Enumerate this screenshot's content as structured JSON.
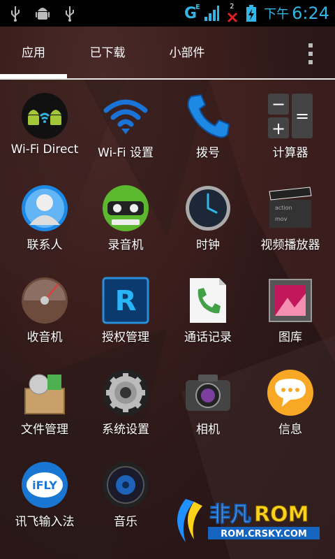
{
  "status_bar": {
    "network": "G",
    "network_sup": "E",
    "sim_slot": "2",
    "time_prefix": "下午",
    "time": "6:24",
    "accent_color": "#33b5e5"
  },
  "tabs": [
    {
      "label": "应用",
      "active": true
    },
    {
      "label": "已下载",
      "active": false
    },
    {
      "label": "小部件",
      "active": false
    }
  ],
  "apps": [
    {
      "label": "Wi-Fi Direct",
      "icon": "wifi-direct-icon"
    },
    {
      "label": "Wi-Fi 设置",
      "icon": "wifi-icon"
    },
    {
      "label": "拨号",
      "icon": "phone-icon"
    },
    {
      "label": "计算器",
      "icon": "calculator-icon"
    },
    {
      "label": "联系人",
      "icon": "contacts-icon"
    },
    {
      "label": "录音机",
      "icon": "recorder-icon"
    },
    {
      "label": "时钟",
      "icon": "clock-icon"
    },
    {
      "label": "视频播放器",
      "icon": "video-player-icon"
    },
    {
      "label": "收音机",
      "icon": "radio-icon"
    },
    {
      "label": "授权管理",
      "icon": "permissions-icon"
    },
    {
      "label": "通话记录",
      "icon": "call-log-icon"
    },
    {
      "label": "图库",
      "icon": "gallery-icon"
    },
    {
      "label": "文件管理",
      "icon": "file-manager-icon"
    },
    {
      "label": "系统设置",
      "icon": "settings-icon"
    },
    {
      "label": "相机",
      "icon": "camera-icon"
    },
    {
      "label": "信息",
      "icon": "messaging-icon"
    },
    {
      "label": "讯飞输入法",
      "icon": "ifly-icon"
    },
    {
      "label": "音乐",
      "icon": "music-icon"
    }
  ],
  "icon_text": {
    "ifly": "iFLY",
    "permissions": "R",
    "calc_minus": "−",
    "calc_eq": "=",
    "calc_plus": "+",
    "video_action": "action",
    "video_mov": "mov"
  },
  "watermark": {
    "brand": "非凡",
    "rom": "ROM",
    "url": "ROM.CRSKY.COM"
  }
}
